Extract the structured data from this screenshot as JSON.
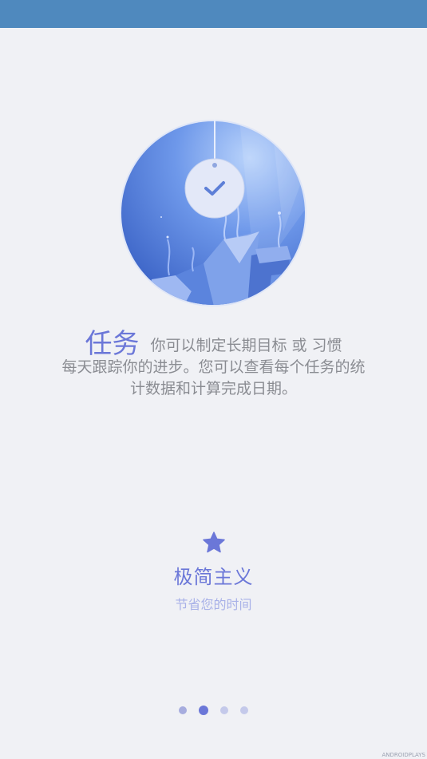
{
  "colors": {
    "status_bar": "#4f89be",
    "background": "#f0f1f5",
    "accent": "#6b77d8",
    "accent_light": "#a8b1e8"
  },
  "hero": {
    "icon": "task-check-illustration"
  },
  "intro": {
    "heading": "任务",
    "line1": "你可以制定长期目标 或 习惯",
    "line2": "每天跟踪你的进步。您可以查看每个任务的统",
    "line3": "计数据和计算完成日期。"
  },
  "feature": {
    "icon": "star-icon",
    "title": "极简主义",
    "subtitle": "节省您的时间"
  },
  "pager": {
    "count": 4,
    "active_index": 1
  },
  "watermark": "ANDROIDPLAYS"
}
